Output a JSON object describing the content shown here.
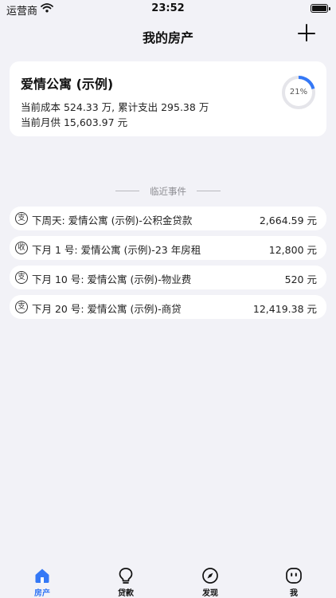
{
  "status_bar": {
    "carrier": "运营商",
    "time": "23:52"
  },
  "nav": {
    "title": "我的房产"
  },
  "property": {
    "name": "爱情公寓 (示例)",
    "line1": "当前成本 524.33 万, 累计支出 295.38 万",
    "line2": "当前月供 15,603.97 元",
    "progress_label": "21%",
    "progress_fraction": 0.21
  },
  "events_section": {
    "label": "临近事件"
  },
  "events": [
    {
      "badge": "支",
      "title": "下周天: 爱情公寓 (示例)-公积金贷款",
      "amount": "2,664.59 元"
    },
    {
      "badge": "收",
      "title": "下月 1 号: 爱情公寓 (示例)-23 年房租",
      "amount": "12,800 元"
    },
    {
      "badge": "支",
      "title": "下月 10 号: 爱情公寓 (示例)-物业费",
      "amount": "520 元"
    },
    {
      "badge": "支",
      "title": "下月 20 号: 爱情公寓 (示例)-商贷",
      "amount": "12,419.38 元"
    }
  ],
  "tabs": [
    {
      "label": "房产",
      "icon": "house-icon",
      "active": true
    },
    {
      "label": "贷款",
      "icon": "lightbulb-icon",
      "active": false
    },
    {
      "label": "发现",
      "icon": "compass-icon",
      "active": false
    },
    {
      "label": "我",
      "icon": "face-icon",
      "active": false
    }
  ],
  "colors": {
    "accent": "#3478f6",
    "ring_track": "#e5e5ea",
    "background": "#f2f2f7"
  }
}
